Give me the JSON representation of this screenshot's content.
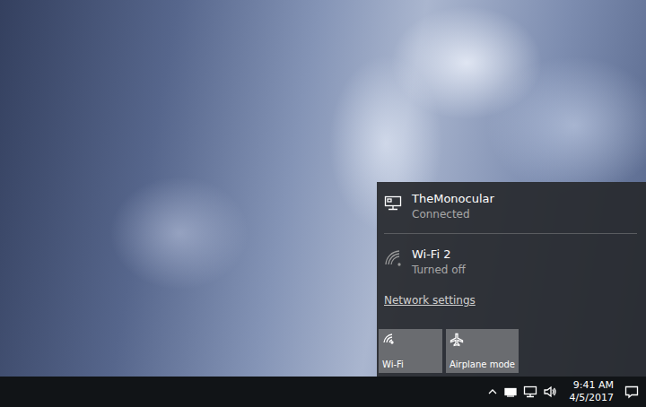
{
  "network_flyout": {
    "networks": [
      {
        "name": "TheMonocular",
        "status": "Connected",
        "kind": "ethernet"
      },
      {
        "name": "Wi-Fi 2",
        "status": "Turned off",
        "kind": "wifi"
      }
    ],
    "settings_link": "Network settings",
    "quick_actions": [
      {
        "label": "Wi-Fi",
        "on": false,
        "kind": "wifi"
      },
      {
        "label": "Airplane mode",
        "on": false,
        "kind": "airplane"
      }
    ]
  },
  "taskbar": {
    "clock": {
      "time": "9:41 AM",
      "date": "4/5/2017"
    }
  }
}
